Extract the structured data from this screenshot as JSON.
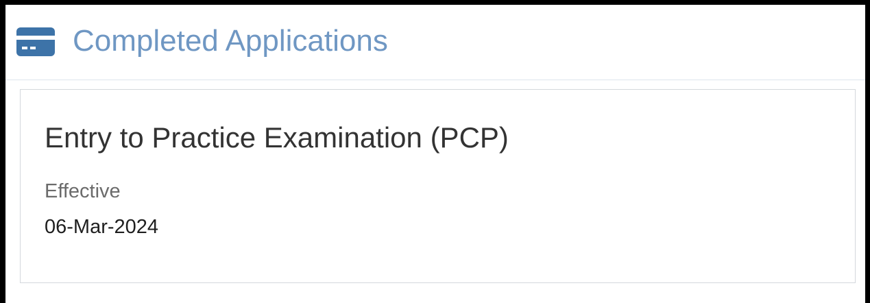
{
  "header": {
    "title": "Completed Applications",
    "icon": "credit-card-icon",
    "icon_color": "#3d73a8",
    "title_color": "#6f97c3"
  },
  "application": {
    "title": "Entry to Practice Examination (PCP)",
    "effective_label": "Effective",
    "effective_date": "06-Mar-2024"
  }
}
